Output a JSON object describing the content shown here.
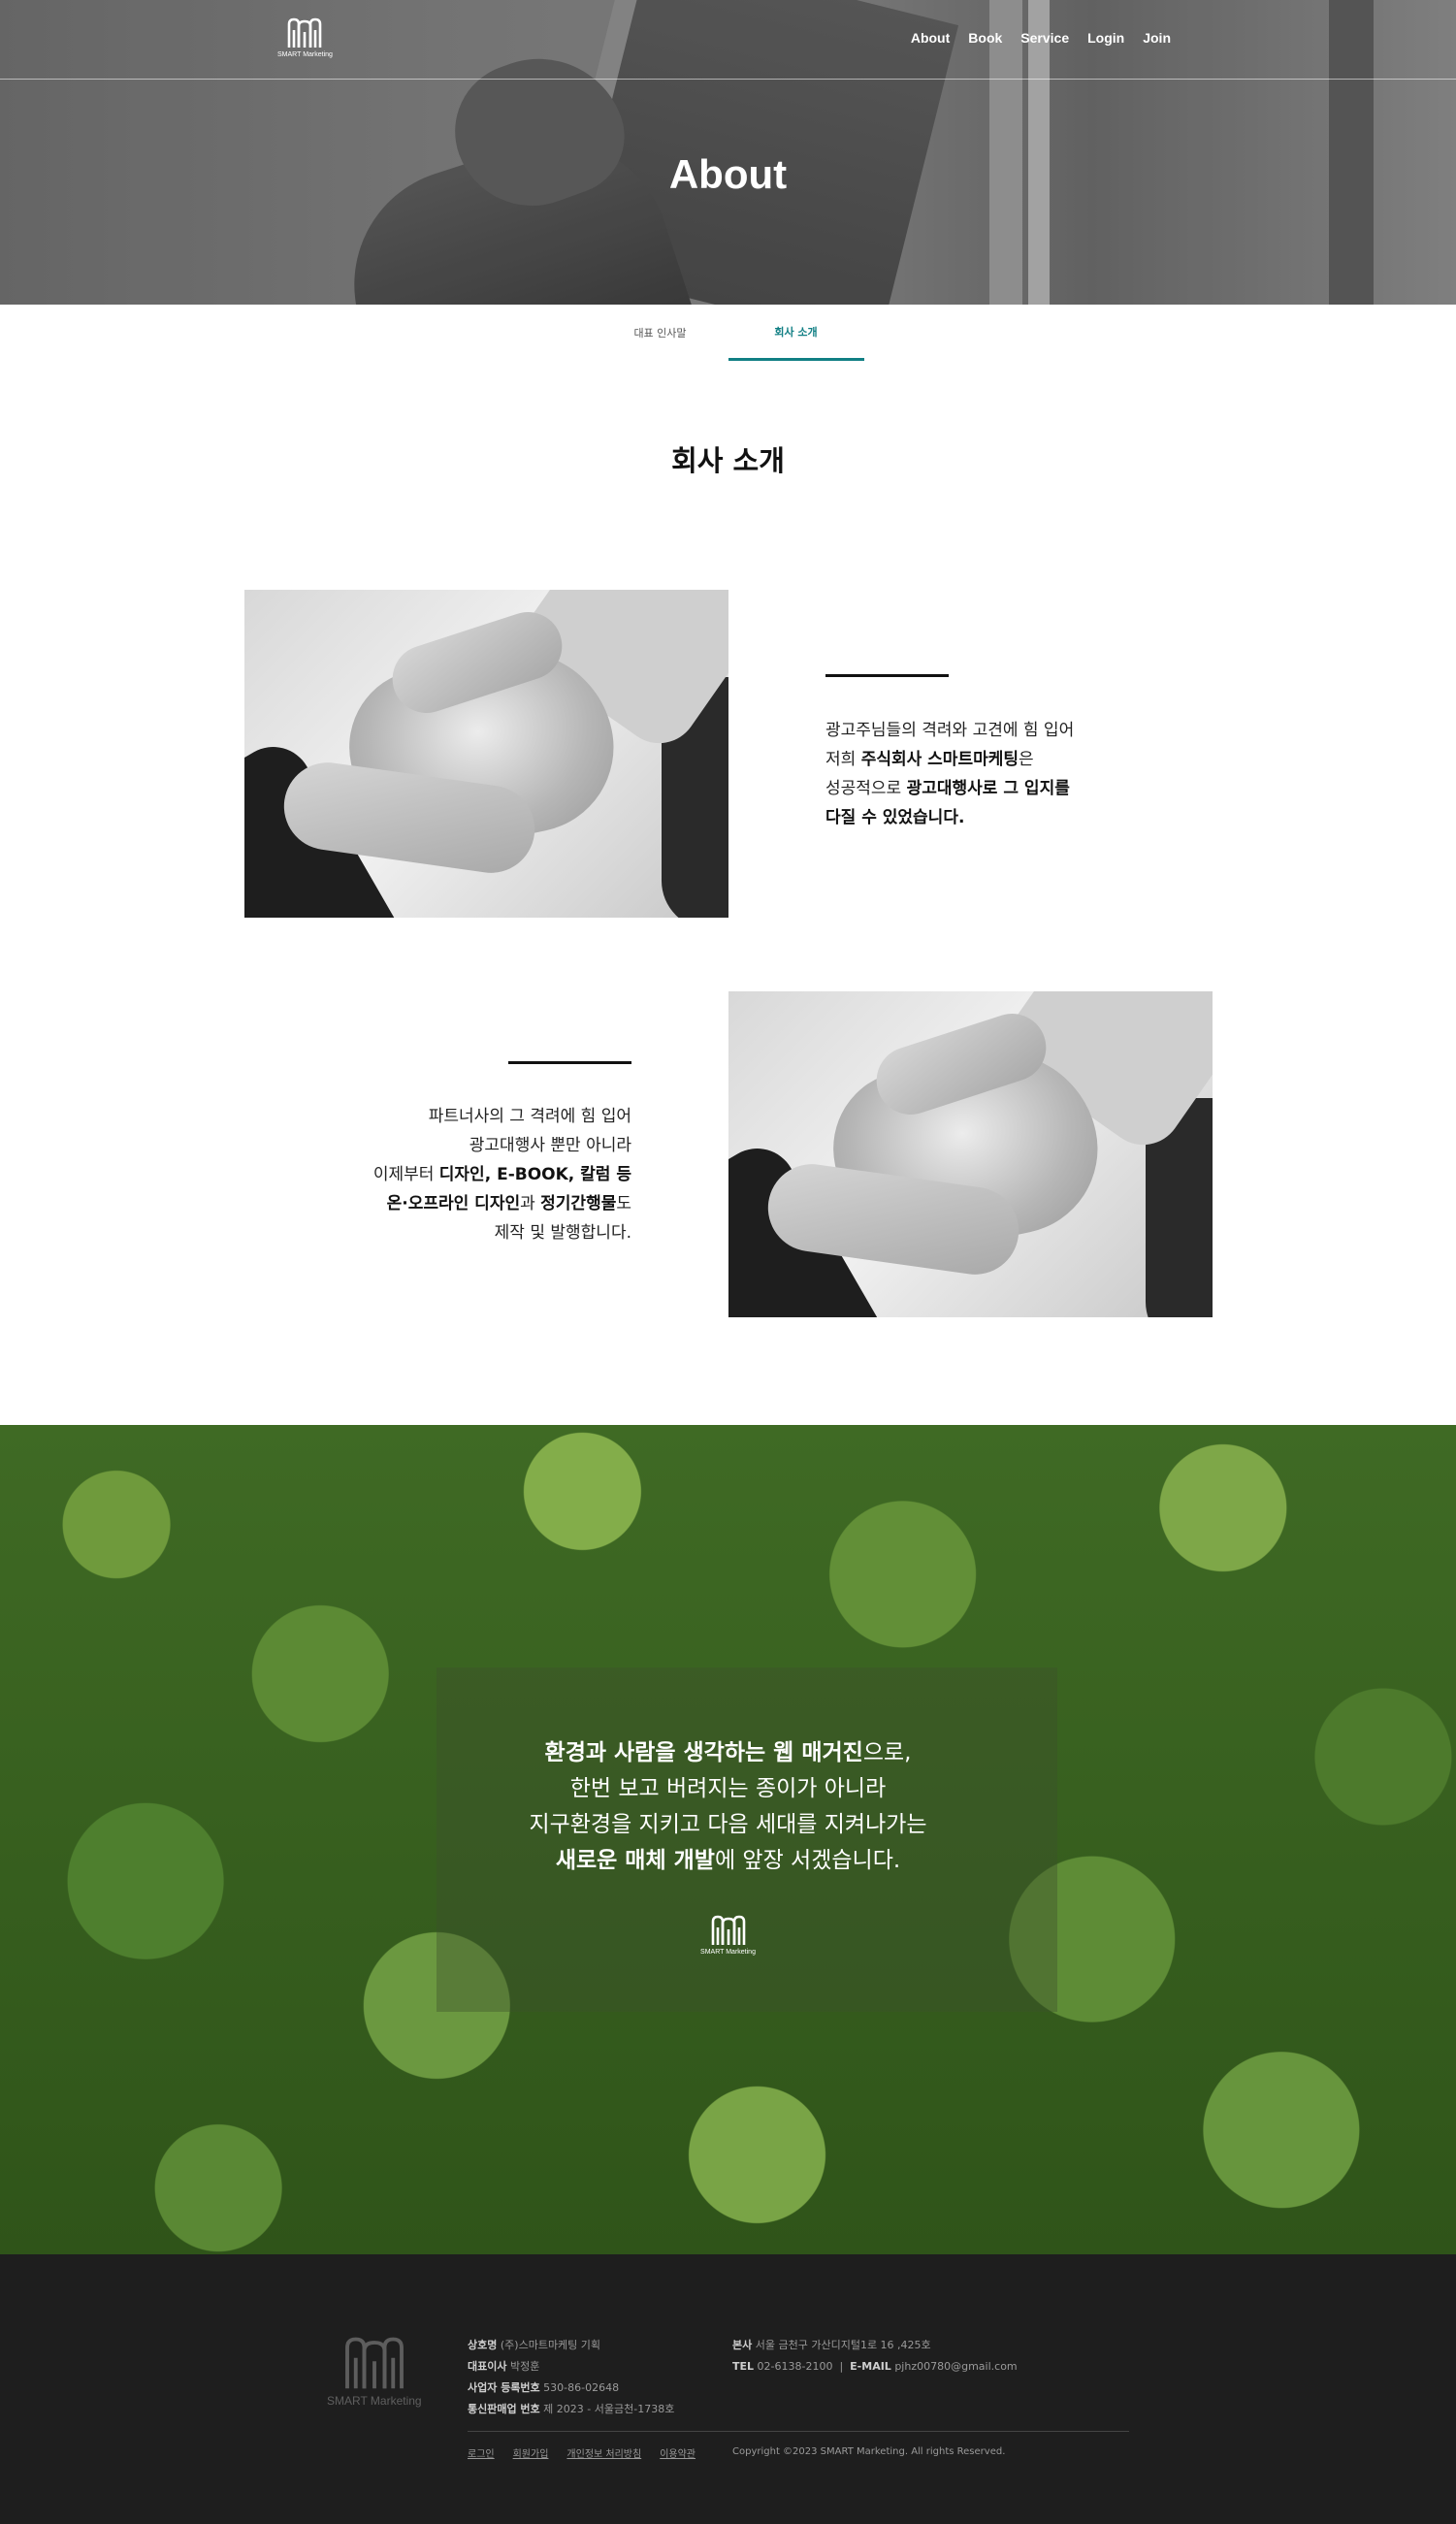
{
  "header": {
    "logo_text": "SMART Marketing",
    "nav": [
      "About",
      "Book",
      "Service",
      "Login",
      "Join"
    ]
  },
  "hero": {
    "title": "About"
  },
  "tabs": [
    {
      "label": "대표 인사말",
      "active": false
    },
    {
      "label": "회사 소개",
      "active": true
    }
  ],
  "section": {
    "title": "회사 소개",
    "block1": {
      "lines": [
        [
          {
            "t": "광고주님들의 격려와 고견에 힘 입어",
            "b": false
          }
        ],
        [
          {
            "t": "저희 ",
            "b": false
          },
          {
            "t": "주식회사 스마트마케팅",
            "b": true
          },
          {
            "t": "은",
            "b": false
          }
        ],
        [
          {
            "t": "성공적으로 ",
            "b": false
          },
          {
            "t": "광고대행사로 그 입지를",
            "b": true
          }
        ],
        [
          {
            "t": "다질 수 있었습니다.",
            "b": true
          }
        ]
      ]
    },
    "block2": {
      "lines": [
        [
          {
            "t": "파트너사의 그 격려에 힘 입어",
            "b": false
          }
        ],
        [
          {
            "t": "광고대행사 뿐만 아니라",
            "b": false
          }
        ],
        [
          {
            "t": "이제부터 ",
            "b": false
          },
          {
            "t": "디자인, E-BOOK, 칼럼 등",
            "b": true
          }
        ],
        [
          {
            "t": "온·오프라인 디자인",
            "b": true
          },
          {
            "t": "과 ",
            "b": false
          },
          {
            "t": "정기간행물",
            "b": true
          },
          {
            "t": "도",
            "b": false
          }
        ],
        [
          {
            "t": "제작 및 발행합니다.",
            "b": false
          }
        ]
      ]
    }
  },
  "forest": {
    "lines": [
      [
        {
          "t": "환경과 사람을 생각하는 웹 매거진",
          "b": true
        },
        {
          "t": "으로,",
          "b": false
        }
      ],
      [
        {
          "t": "한번 보고 버려지는 종이가 아니라",
          "b": false
        }
      ],
      [
        {
          "t": "지구환경을 지키고 다음 세대를 지켜나가는",
          "b": false
        }
      ],
      [
        {
          "t": "새로운 매체 개발",
          "b": true
        },
        {
          "t": "에 앞장 서겠습니다.",
          "b": false
        }
      ]
    ],
    "logo_text": "SMART Marketing"
  },
  "footer": {
    "logo_text": "SMART Marketing",
    "info_left": [
      {
        "k": "상호명",
        "v": "(주)스마트마케팅 기획"
      },
      {
        "k": "대표이사",
        "v": "박정훈"
      },
      {
        "k": "사업자 등록번호",
        "v": "530-86-02648"
      },
      {
        "k": "통신판매업 번호",
        "v": "제 2023 - 서울금천-1738호"
      }
    ],
    "info_right": [
      [
        {
          "k": "본사",
          "v": "서울 금천구 가산디지털1로 16 ,425호"
        }
      ],
      [
        {
          "k": "TEL",
          "v": "02-6138-2100"
        },
        {
          "k": "E-MAIL",
          "v": "pjhz00780@gmail.com"
        }
      ]
    ],
    "links": [
      "로그인",
      "회원가입",
      "개인정보 처리방침",
      "이용약관"
    ],
    "copyright": "Copyright ©2023 SMART Marketing. All rights Reserved."
  },
  "colors": {
    "accent": "#117f84",
    "footer_bg": "#1e1e1e"
  }
}
